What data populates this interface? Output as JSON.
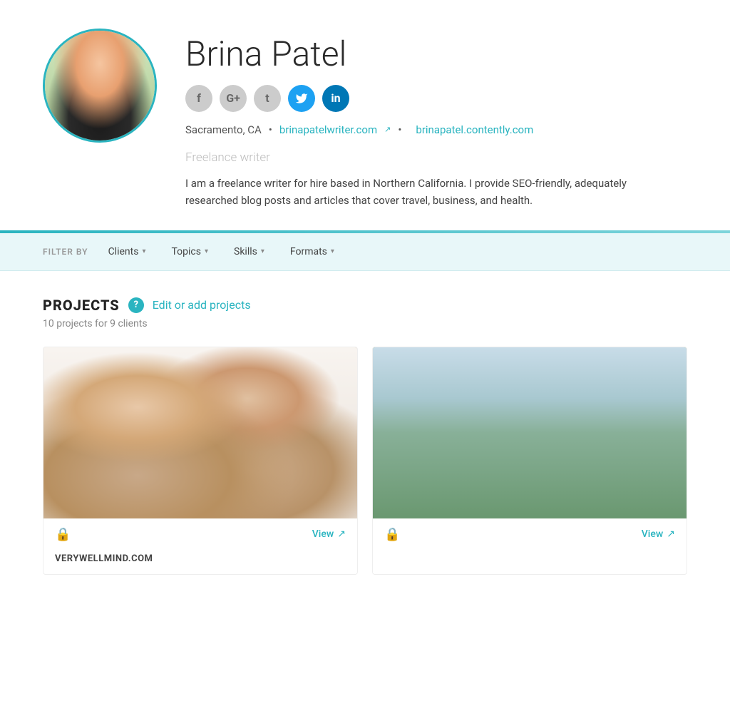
{
  "profile": {
    "name": "Brina Patel",
    "location": "Sacramento, CA",
    "website": "brinapatelwriter.com",
    "contently_url": "brinapatel.contently.com",
    "tagline": "Freelance writer",
    "bio": "I am a freelance writer for hire based in Northern California. I provide SEO-friendly, adequately researched blog posts and articles that cover travel, business, and health.",
    "avatar_alt": "Brina Patel profile photo"
  },
  "social": {
    "facebook_label": "f",
    "googleplus_label": "G+",
    "tumblr_label": "t",
    "twitter_label": "t",
    "linkedin_label": "in"
  },
  "filter_bar": {
    "label": "FILTER BY",
    "clients": "Clients",
    "topics": "Topics",
    "skills": "Skills",
    "formats": "Formats"
  },
  "projects": {
    "title": "PROJECTS",
    "help_label": "?",
    "edit_label": "Edit or add projects",
    "count": "10 projects for 9 clients",
    "items": [
      {
        "client": "VERYWELLMIND.COM",
        "view_label": "View",
        "locked": true
      },
      {
        "client": "",
        "view_label": "View",
        "locked": true
      }
    ]
  }
}
